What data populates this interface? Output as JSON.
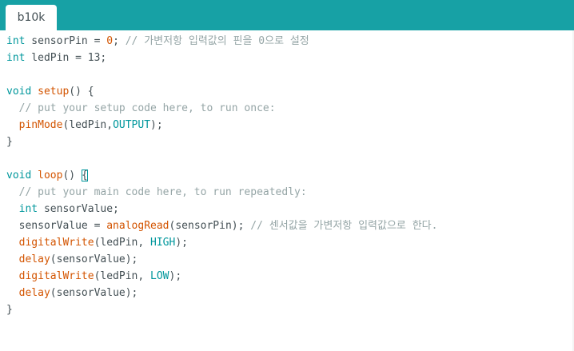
{
  "tab": {
    "label": "b10k"
  },
  "code": {
    "l1": {
      "kw": "int",
      "name": " sensorPin = ",
      "num": "0",
      "rest": ";",
      "comment": " // 가변저항 입력값의 핀을 0으로 설정"
    },
    "l2": {
      "kw": "int",
      "rest": " ledPin = 13;"
    },
    "l4": {
      "kw": "void",
      "fn": " setup",
      "rest": "() {"
    },
    "l5": {
      "comment": "  // put your setup code here, to run once:"
    },
    "l6": {
      "fn": "  pinMode",
      "pre": "(ledPin,",
      "const": "OUTPUT",
      "post": ");"
    },
    "l7": {
      "text": "}"
    },
    "l9": {
      "kw": "void",
      "fn": " loop",
      "pre": "() ",
      "brace": "{"
    },
    "l10": {
      "comment": "  // put your main code here, to run repeatedly:"
    },
    "l11": {
      "indent": "  ",
      "kw": "int",
      "rest": " sensorValue;"
    },
    "l12": {
      "pre": "  sensorValue = ",
      "fn": "analogRead",
      "post": "(sensorPin);",
      "comment": " // 센서값을 가변저항 입력값으로 한다."
    },
    "l13": {
      "fn": "  digitalWrite",
      "pre": "(ledPin, ",
      "const": "HIGH",
      "post": ");"
    },
    "l14": {
      "fn": "  delay",
      "post": "(sensorValue);"
    },
    "l15": {
      "fn": "  digitalWrite",
      "pre": "(ledPin, ",
      "const": "LOW",
      "post": ");"
    },
    "l16": {
      "fn": "  delay",
      "post": "(sensorValue);"
    },
    "l17": {
      "text": "}"
    }
  }
}
